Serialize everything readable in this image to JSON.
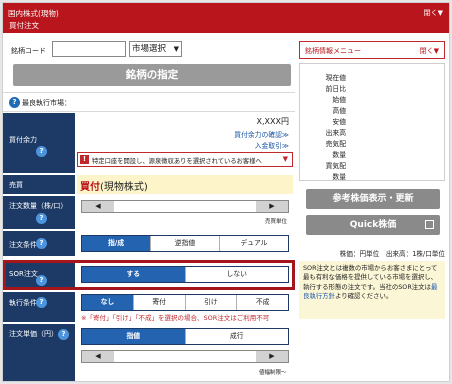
{
  "header": {
    "category": "国内株式(現物)",
    "title": "買付注文",
    "close_label": "閉く▼"
  },
  "code_field": {
    "label": "銘柄コード",
    "value": "",
    "market_select": "市場選択"
  },
  "stock_menu": {
    "label": "銘柄情報メニュー",
    "toggle": "閉く▼"
  },
  "specify_button": "銘柄の指定",
  "best_exec_market": {
    "label": "最良執行市場："
  },
  "buying_power": {
    "label": "買付余力",
    "amount": "X,XXX円",
    "link_check": "買付余力の確認≫",
    "link_deposit": "入金取引≫",
    "warning": "特定口座を開設し、源泉徴収ありを選択されているお客様へ",
    "warning_arrow": "▼"
  },
  "trade": {
    "label": "売買",
    "value": "買付",
    "value_suffix": "(現物株式)"
  },
  "quantity": {
    "label": "注文数量（株/口）",
    "unit_caption": "売買単位"
  },
  "order_condition": {
    "label": "注文条件",
    "options": [
      "指/成",
      "逆指値",
      "デュアル"
    ]
  },
  "sor": {
    "label": "SOR注文",
    "options": [
      "する",
      "しない"
    ]
  },
  "exec_condition": {
    "label": "執行条件",
    "options": [
      "なし",
      "寄付",
      "引け",
      "不成"
    ],
    "note": "※「寄付」「引け」「不成」を選択の場合、SOR注文はご利用不可"
  },
  "order_price": {
    "label": "注文単価（円）",
    "options": [
      "指値",
      "成行"
    ],
    "unit_caption": "値幅制限～"
  },
  "quote": {
    "rows": [
      "現在値",
      "前日比",
      "始値",
      "高値",
      "安値",
      "出来高",
      "売気配",
      "数量",
      "買気配",
      "数量"
    ]
  },
  "refresh_button": "参考株価表示・更新",
  "quick_button": "Quick株価",
  "unit_line": "株価：円単位　出来高：1株/口単位",
  "sor_note": {
    "text1": "SOR注文とは複数の市場からお客さまにとって最も有利な価格を提供している市場を選択し、執行する形態の注文です。",
    "text2": "当社のSOR注文は",
    "link": "最良執行方針",
    "text3": "より確認ください。"
  },
  "colors": {
    "header_red": "#b8151c",
    "label_navy": "#1d3a66",
    "toggle_blue": "#2363b0",
    "highlight_red": "#a4151c"
  }
}
